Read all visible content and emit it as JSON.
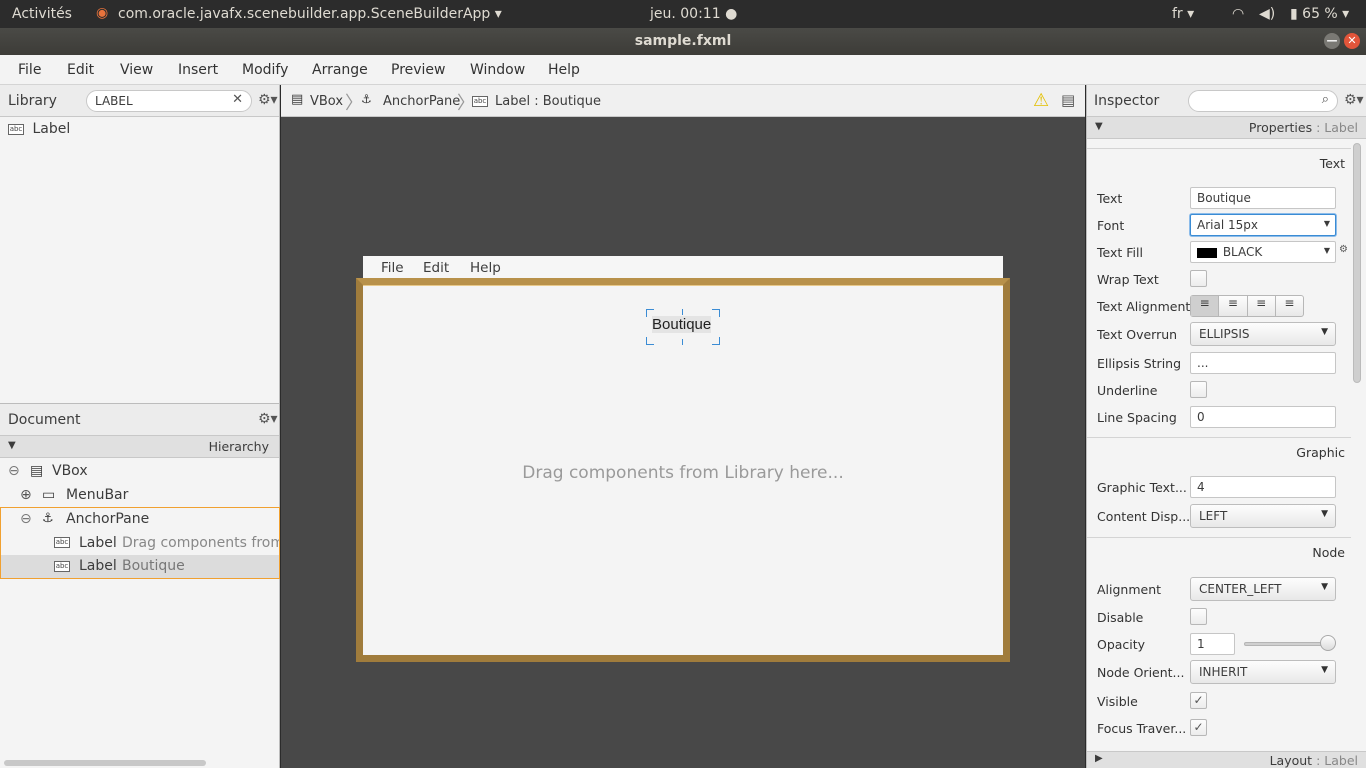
{
  "topbar": {
    "activities": "Activités",
    "app_name": "com.oracle.javafx.scenebuilder.app.SceneBuilderApp",
    "clock": "jeu. 00:11",
    "lang": "fr",
    "battery": "65 %"
  },
  "window": {
    "title": "sample.fxml"
  },
  "menu": [
    "File",
    "Edit",
    "View",
    "Insert",
    "Modify",
    "Arrange",
    "Preview",
    "Window",
    "Help"
  ],
  "library": {
    "title": "Library",
    "search_value": "LABEL",
    "items": [
      "Label"
    ]
  },
  "document": {
    "title": "Document",
    "section": "Hierarchy",
    "tree": [
      {
        "type": "VBox",
        "text": ""
      },
      {
        "type": "MenuBar",
        "text": ""
      },
      {
        "type": "AnchorPane",
        "text": ""
      },
      {
        "type": "Label",
        "text": "Drag components from L"
      },
      {
        "type": "Label",
        "text": "Boutique"
      }
    ]
  },
  "breadcrumb": [
    "VBox",
    "AnchorPane",
    "Label : Boutique"
  ],
  "canvas": {
    "menu": [
      "File",
      "Edit",
      "Help"
    ],
    "label_text": "Boutique",
    "placeholder": "Drag components from Library here..."
  },
  "inspector": {
    "title": "Inspector",
    "properties_header": "Properties",
    "properties_target": ": Label",
    "sections": {
      "text": "Text",
      "graphic": "Graphic",
      "node": "Node"
    },
    "labels": {
      "text": "Text",
      "font": "Font",
      "text_fill": "Text Fill",
      "wrap_text": "Wrap Text",
      "text_alignment": "Text Alignment",
      "text_overrun": "Text Overrun",
      "ellipsis_string": "Ellipsis String",
      "underline": "Underline",
      "line_spacing": "Line Spacing",
      "graphic_text": "Graphic Text...",
      "content_display": "Content Disp...",
      "alignment": "Alignment",
      "disable": "Disable",
      "opacity": "Opacity",
      "node_orientation": "Node Orient...",
      "visible": "Visible",
      "focus_traversable": "Focus Traver..."
    },
    "values": {
      "text": "Boutique",
      "font": "Arial 15px",
      "text_fill": "BLACK",
      "text_overrun": "ELLIPSIS",
      "ellipsis_string": "...",
      "line_spacing": "0",
      "graphic_text": "4",
      "content_display": "LEFT",
      "alignment": "CENTER_LEFT",
      "opacity": "1",
      "node_orientation": "INHERIT"
    },
    "layout_header": "Layout",
    "layout_target": ": Label"
  },
  "colors": {
    "selection": "#f0a030",
    "canvas_border": "#a07c3c",
    "accent_focus": "#3b8cd4"
  }
}
